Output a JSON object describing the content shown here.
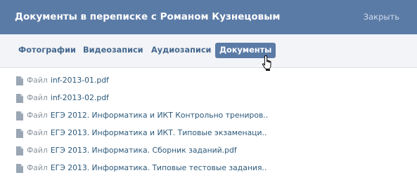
{
  "header": {
    "title": "Документы в переписке с Романом Кузнецовым",
    "close_label": "Закрыть"
  },
  "tabs": [
    {
      "label": "Фотографии",
      "active": false
    },
    {
      "label": "Видеозаписи",
      "active": false
    },
    {
      "label": "Аудиозаписи",
      "active": false
    },
    {
      "label": "Документы",
      "active": true
    }
  ],
  "files": [
    {
      "prefix": "Файл",
      "name": "inf-2013-01.pdf"
    },
    {
      "prefix": "Файл",
      "name": "inf-2013-02.pdf"
    },
    {
      "prefix": "Файл",
      "name": "ЕГЭ 2012. Информатика и ИКТ Контрольно трениров.."
    },
    {
      "prefix": "Файл",
      "name": "ЕГЭ 2013. Информатика и ИКТ. Типовые экзаменаци.."
    },
    {
      "prefix": "Файл",
      "name": "ЕГЭ 2013. Информатика. Сборник заданий.pdf"
    },
    {
      "prefix": "Файл",
      "name": "ЕГЭ 2013. Информатика. Типовые тестовые задания.."
    }
  ],
  "colors": {
    "header_bg": "#5b7ba7",
    "tabs_bg": "#f2f4f7",
    "link": "#2b587a",
    "tab_text": "#45688e"
  },
  "icons": {
    "file": "document-icon",
    "cursor": "hand-pointer-icon"
  }
}
